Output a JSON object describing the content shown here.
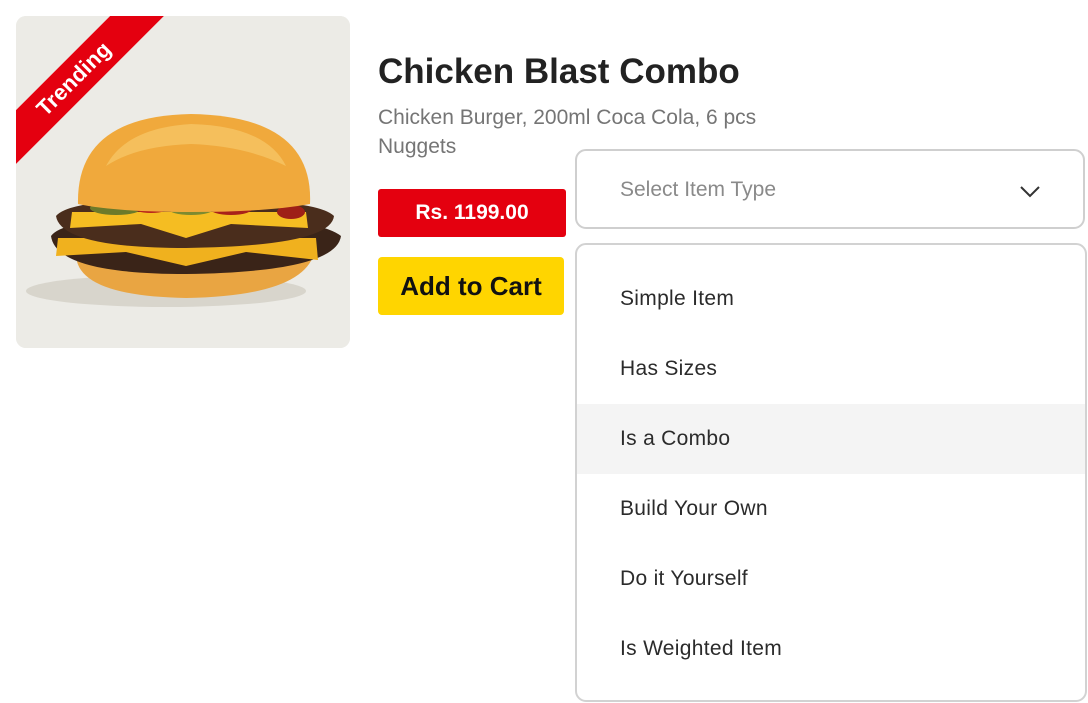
{
  "product": {
    "badge": "Trending",
    "title": "Chicken Blast Combo",
    "description": "Chicken Burger, 200ml Coca Cola, 6 pcs Nuggets",
    "price": "Rs. 1199.00",
    "add_to_cart_label": "Add to Cart",
    "image_icon": "burger-photo"
  },
  "item_type_select": {
    "placeholder": "Select Item Type",
    "icon": "chevron-down-icon",
    "options": [
      {
        "label": "Simple Item"
      },
      {
        "label": "Has Sizes"
      },
      {
        "label": "Is a Combo",
        "highlighted": true
      },
      {
        "label": "Build Your Own"
      },
      {
        "label": "Do it Yourself"
      },
      {
        "label": "Is Weighted Item"
      }
    ]
  },
  "colors": {
    "brand_red": "#e4000f",
    "cart_yellow": "#ffd500",
    "highlight_bg": "#f4f4f4"
  }
}
